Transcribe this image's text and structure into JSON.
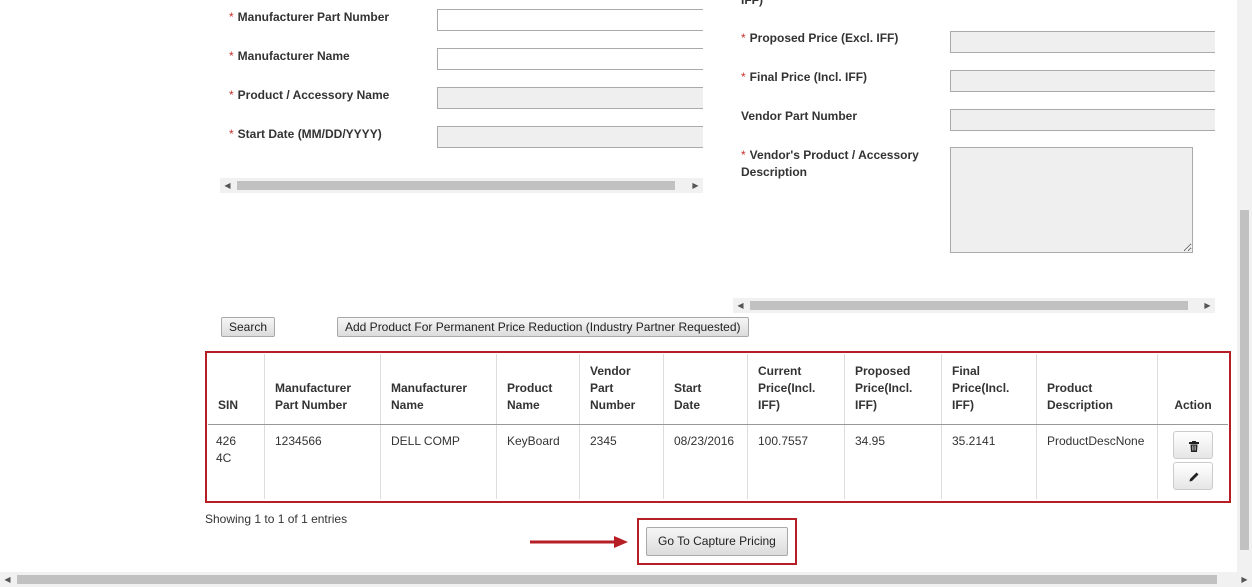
{
  "form_left": {
    "fields": [
      {
        "label": "Manufacturer Part Number",
        "required": "*",
        "value": ""
      },
      {
        "label": "Manufacturer Name",
        "required": "*",
        "value": ""
      },
      {
        "label": "Product / Accessory Name",
        "required": "*",
        "value": ""
      },
      {
        "label": "Start Date (MM/DD/YYYY)",
        "required": "*",
        "value": ""
      }
    ]
  },
  "form_right": {
    "truncated_label": "IFF)",
    "fields": [
      {
        "label": "Proposed Price (Excl. IFF)",
        "required": "*",
        "value": ""
      },
      {
        "label": "Final Price (Incl. IFF)",
        "required": "*",
        "value": ""
      },
      {
        "label": "Vendor Part Number",
        "required": "",
        "value": ""
      },
      {
        "label_line1": "Vendor's Product / Accessory",
        "label_line2": "Description",
        "required": "*",
        "value": ""
      }
    ]
  },
  "buttons": {
    "search": "Search",
    "add_product": "Add Product For Permanent Price Reduction (Industry Partner Requested)",
    "capture_pricing": "Go To Capture Pricing"
  },
  "table": {
    "headers": [
      [
        "SIN"
      ],
      [
        "Manufacturer",
        "Part Number"
      ],
      [
        "Manufacturer",
        "Name"
      ],
      [
        "Product",
        "Name"
      ],
      [
        "Vendor",
        "Part",
        "Number"
      ],
      [
        "Start",
        "Date"
      ],
      [
        "Current",
        "Price(Incl.",
        "IFF)"
      ],
      [
        "Proposed",
        "Price(Incl.",
        "IFF)"
      ],
      [
        "Final",
        "Price(Incl.",
        "IFF)"
      ],
      [
        "Product",
        "Description"
      ],
      [
        "Action"
      ]
    ],
    "rows": [
      {
        "sin_line1": "426",
        "sin_line2": "4C",
        "manufacturer_part_number": "1234566",
        "manufacturer_name": "DELL COMP",
        "product_name": "KeyBoard",
        "vendor_part_number": "2345",
        "start_date": "08/23/2016",
        "current_price": "100.7557",
        "proposed_price": "34.95",
        "final_price": "35.2141",
        "product_description": "ProductDescNone"
      }
    ],
    "info": "Showing 1 to 1 of 1 entries"
  },
  "colors": {
    "highlight": "#b41e24",
    "required": "#c9302c"
  },
  "icons": [
    "trash-icon",
    "pencil-icon",
    "arrow-right-icon"
  ]
}
